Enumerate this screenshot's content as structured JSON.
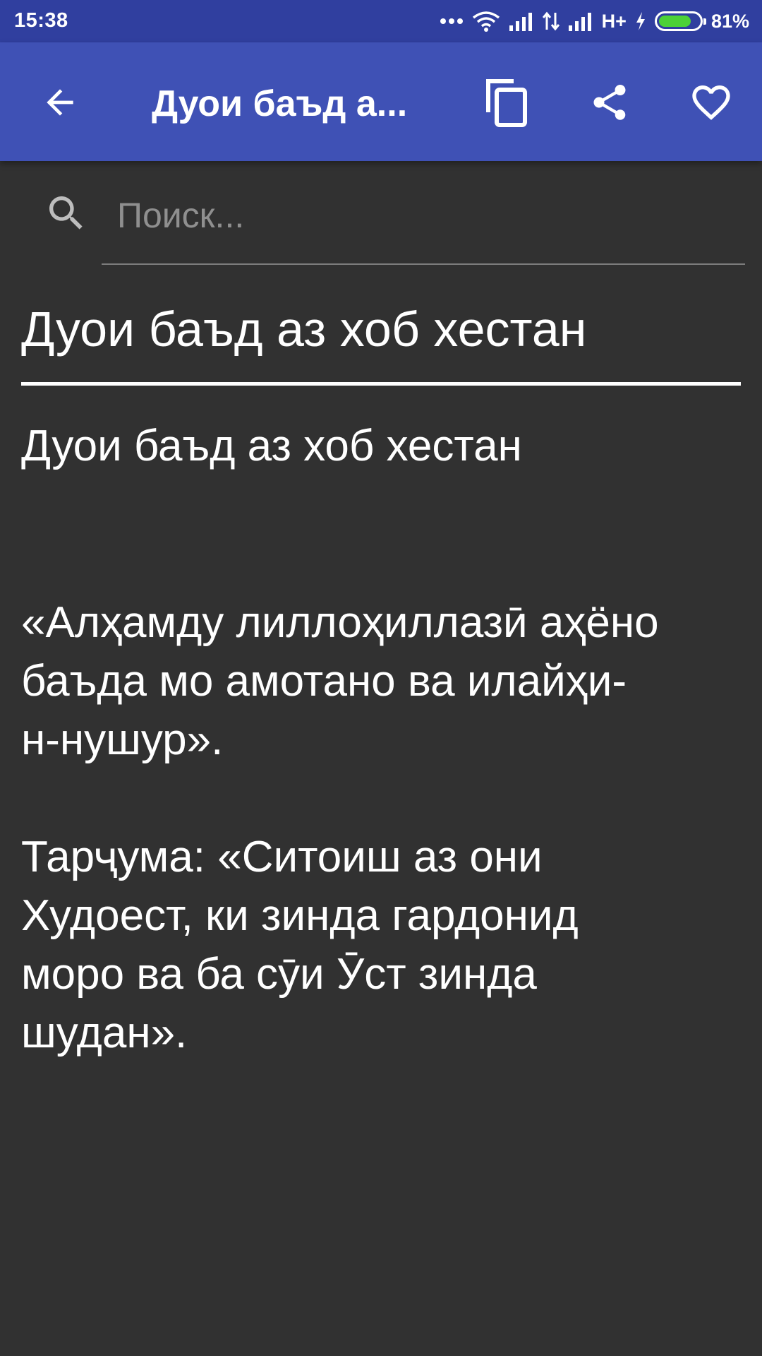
{
  "status_bar": {
    "time": "15:38",
    "network_label": "H+",
    "battery_percent": "81%",
    "battery_level": 0.81
  },
  "app_bar": {
    "title": "Дуои баъд а...",
    "icons": [
      "back-arrow-icon",
      "copy-icon",
      "share-icon",
      "heart-icon"
    ]
  },
  "search": {
    "placeholder": "Поиск...",
    "value": ""
  },
  "content": {
    "title": "Дуои баъд аз хоб хестан",
    "subtitle": "Дуои баъд аз хоб хестан",
    "prayer": "«Алҳамду лиллоҳиллазӣ аҳёно\nбаъда мо амотано ва илайҳи-\nн-нушур».",
    "translation": "Тарҷума: «Ситоиш аз они\nХудоест, ки зинда гардонид\nморо ва ба сӯи Ӯст зинда\nшудан»."
  },
  "colors": {
    "status_bar": "#303f9f",
    "app_bar": "#3f51b5",
    "background": "#313131",
    "battery_fill": "#4cd137"
  }
}
